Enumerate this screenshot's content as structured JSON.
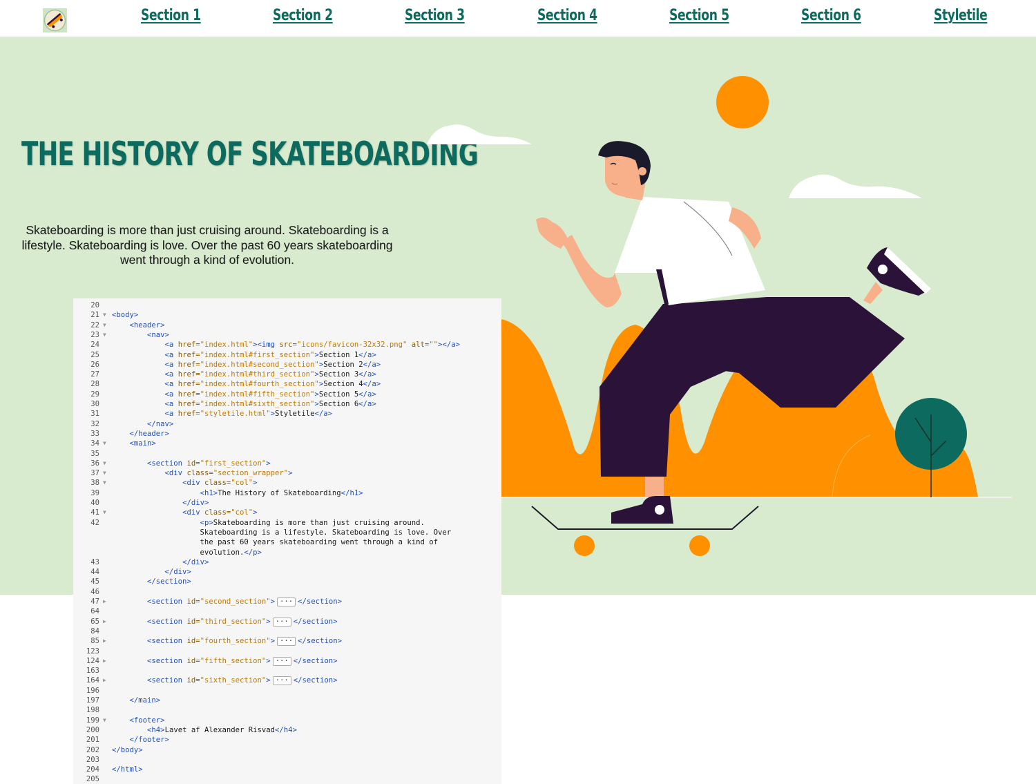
{
  "nav": {
    "logo_icon": "skateboard-logo-icon",
    "links": [
      "Section 1",
      "Section 2",
      "Section 3",
      "Section 4",
      "Section 5",
      "Section 6",
      "Styletile"
    ]
  },
  "hero": {
    "title": "The History of Skateboarding",
    "text": "Skateboarding is more than just cruising around. Skateboarding is a lifestyle. Skateboarding is love. Over the past 60 years skateboarding went through a kind of evolution.",
    "illustration_icon": "skateboarder-illustration"
  },
  "colors": {
    "brand_green": "#0c6b5e",
    "hero_bg": "#d8ebcf",
    "accent_orange": "#ff9100",
    "dark_purple": "#2b1238"
  },
  "code": {
    "lines": [
      {
        "n": "20",
        "fold": "",
        "text": ""
      },
      {
        "n": "21",
        "fold": "open",
        "text": "<body>"
      },
      {
        "n": "22",
        "fold": "open",
        "text": "    <header>"
      },
      {
        "n": "23",
        "fold": "open",
        "text": "        <nav>"
      },
      {
        "n": "24",
        "fold": "",
        "text": "            <a href=\"index.html\"><img src=\"icons/favicon-32x32.png\" alt=\"\"></a>"
      },
      {
        "n": "25",
        "fold": "",
        "text": "            <a href=\"index.html#first_section\">Section 1</a>"
      },
      {
        "n": "26",
        "fold": "",
        "text": "            <a href=\"index.html#second_section\">Section 2</a>"
      },
      {
        "n": "27",
        "fold": "",
        "text": "            <a href=\"index.html#third_section\">Section 3</a>"
      },
      {
        "n": "28",
        "fold": "",
        "text": "            <a href=\"index.html#fourth_section\">Section 4</a>"
      },
      {
        "n": "29",
        "fold": "",
        "text": "            <a href=\"index.html#fifth_section\">Section 5</a>"
      },
      {
        "n": "30",
        "fold": "",
        "text": "            <a href=\"index.html#sixth_section\">Section 6</a>"
      },
      {
        "n": "31",
        "fold": "",
        "text": "            <a href=\"styletile.html\">Styletile</a>"
      },
      {
        "n": "32",
        "fold": "",
        "text": "        </nav>"
      },
      {
        "n": "33",
        "fold": "",
        "text": "    </header>"
      },
      {
        "n": "34",
        "fold": "open",
        "text": "    <main>"
      },
      {
        "n": "35",
        "fold": "",
        "text": ""
      },
      {
        "n": "36",
        "fold": "open",
        "text": "        <section id=\"first_section\">"
      },
      {
        "n": "37",
        "fold": "open",
        "text": "            <div class=\"section_wrapper\">"
      },
      {
        "n": "38",
        "fold": "open",
        "text": "                <div class=\"col\">"
      },
      {
        "n": "39",
        "fold": "",
        "text": "                    <h1>The History of Skateboarding</h1>"
      },
      {
        "n": "40",
        "fold": "",
        "text": "                </div>"
      },
      {
        "n": "41",
        "fold": "open",
        "text": "                <div class=\"col\">"
      },
      {
        "n": "42",
        "fold": "",
        "text": "                    <p>Skateboarding is more than just cruising around."
      },
      {
        "n": "",
        "fold": "",
        "text": "                    Skateboarding is a lifestyle. Skateboarding is love. Over"
      },
      {
        "n": "",
        "fold": "",
        "text": "                    the past 60 years skateboarding went through a kind of"
      },
      {
        "n": "",
        "fold": "",
        "text": "                    evolution.</p>"
      },
      {
        "n": "43",
        "fold": "",
        "text": "                </div>"
      },
      {
        "n": "44",
        "fold": "",
        "text": "            </div>"
      },
      {
        "n": "45",
        "fold": "",
        "text": "        </section>"
      },
      {
        "n": "46",
        "fold": "",
        "text": ""
      },
      {
        "n": "47",
        "fold": "closed",
        "text": "        <section id=\"second_section\">",
        "collapsed": true,
        "after": "</section>"
      },
      {
        "n": "64",
        "fold": "",
        "text": ""
      },
      {
        "n": "65",
        "fold": "closed",
        "text": "        <section id=\"third_section\">",
        "collapsed": true,
        "after": "</section>"
      },
      {
        "n": "84",
        "fold": "",
        "text": ""
      },
      {
        "n": "85",
        "fold": "closed",
        "text": "        <section id=\"fourth_section\">",
        "collapsed": true,
        "after": "</section>"
      },
      {
        "n": "123",
        "fold": "",
        "text": ""
      },
      {
        "n": "124",
        "fold": "closed",
        "text": "        <section id=\"fifth_section\">",
        "collapsed": true,
        "after": "</section>"
      },
      {
        "n": "163",
        "fold": "",
        "text": ""
      },
      {
        "n": "164",
        "fold": "closed",
        "text": "        <section id=\"sixth_section\">",
        "collapsed": true,
        "after": "</section>"
      },
      {
        "n": "196",
        "fold": "",
        "text": ""
      },
      {
        "n": "197",
        "fold": "",
        "text": "    </main>"
      },
      {
        "n": "198",
        "fold": "",
        "text": ""
      },
      {
        "n": "199",
        "fold": "open",
        "text": "    <footer>"
      },
      {
        "n": "200",
        "fold": "",
        "text": "        <h4>Lavet af Alexander Risvad</h4>"
      },
      {
        "n": "201",
        "fold": "",
        "text": "    </footer>"
      },
      {
        "n": "202",
        "fold": "",
        "text": "</body>"
      },
      {
        "n": "203",
        "fold": "",
        "text": ""
      },
      {
        "n": "204",
        "fold": "",
        "text": "</html>"
      },
      {
        "n": "205",
        "fold": "",
        "text": ""
      }
    ],
    "collapsed_marker": "···"
  }
}
